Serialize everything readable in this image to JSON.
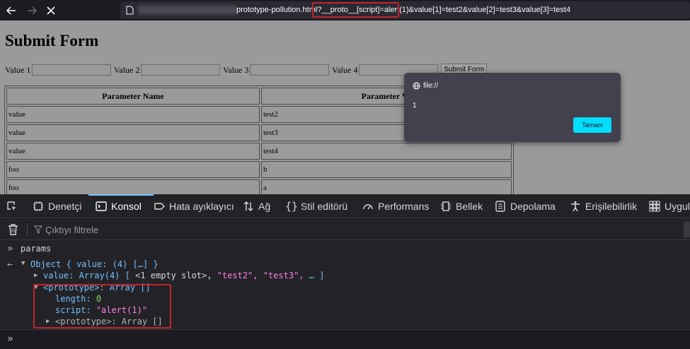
{
  "browser": {
    "url_visible": "prototype-pollution.html?__proto__[script]=alert(1)&value[1]=test2&value[2]=test3&value[3]=test4"
  },
  "page": {
    "heading": "Submit Form",
    "inputs": [
      {
        "label": "Value 1",
        "value": ""
      },
      {
        "label": "Value 2",
        "value": ""
      },
      {
        "label": "Value 3",
        "value": ""
      },
      {
        "label": "Value 4",
        "value": ""
      }
    ],
    "submit_label": "Submit Form",
    "table": {
      "headers": [
        "Parameter Name",
        "Parameter Va"
      ],
      "rows": [
        [
          "value",
          "test2"
        ],
        [
          "value",
          "test3"
        ],
        [
          "value",
          "test4"
        ],
        [
          "foo",
          "b"
        ],
        [
          "foo",
          "a"
        ]
      ]
    }
  },
  "dialog": {
    "origin": "file://",
    "message": "1",
    "ok_label": "Tamam"
  },
  "devtools": {
    "tabs": [
      {
        "label": "Denetçi",
        "icon": "inspector-icon"
      },
      {
        "label": "Konsol",
        "icon": "console-icon",
        "active": true
      },
      {
        "label": "Hata ayıklayıcı",
        "icon": "debugger-icon"
      },
      {
        "label": "Ağ",
        "icon": "network-icon"
      },
      {
        "label": "Stil editörü",
        "icon": "style-editor-icon"
      },
      {
        "label": "Performans",
        "icon": "performance-icon"
      },
      {
        "label": "Bellek",
        "icon": "memory-icon"
      },
      {
        "label": "Depolama",
        "icon": "storage-icon"
      },
      {
        "label": "Erişilebilirlik",
        "icon": "accessibility-icon"
      },
      {
        "label": "Uygul",
        "icon": "application-icon"
      }
    ],
    "filter_placeholder": "Çıktıyı filtrele",
    "console": {
      "input_echo": "params",
      "object_line": "Object { value: (4) […] }",
      "value_line_key": "value:",
      "value_line_type": "Array(4)",
      "value_line_open": "[",
      "value_line_empty": "<1 empty slot>,",
      "value_line_s1": "\"test2\",",
      "value_line_s2": "\"test3\",",
      "value_line_rest": "… ]",
      "proto_line": "<prototype>: Array []",
      "length_key": "length:",
      "length_val": "0",
      "script_key": "script:",
      "script_val": "\"alert(1)\"",
      "proto_inner": "<prototype>: Array []"
    }
  },
  "colors": {
    "highlight_border": "#c0242c",
    "dialog_button": "#00ddff",
    "active_tab_indicator": "#75bfff"
  }
}
